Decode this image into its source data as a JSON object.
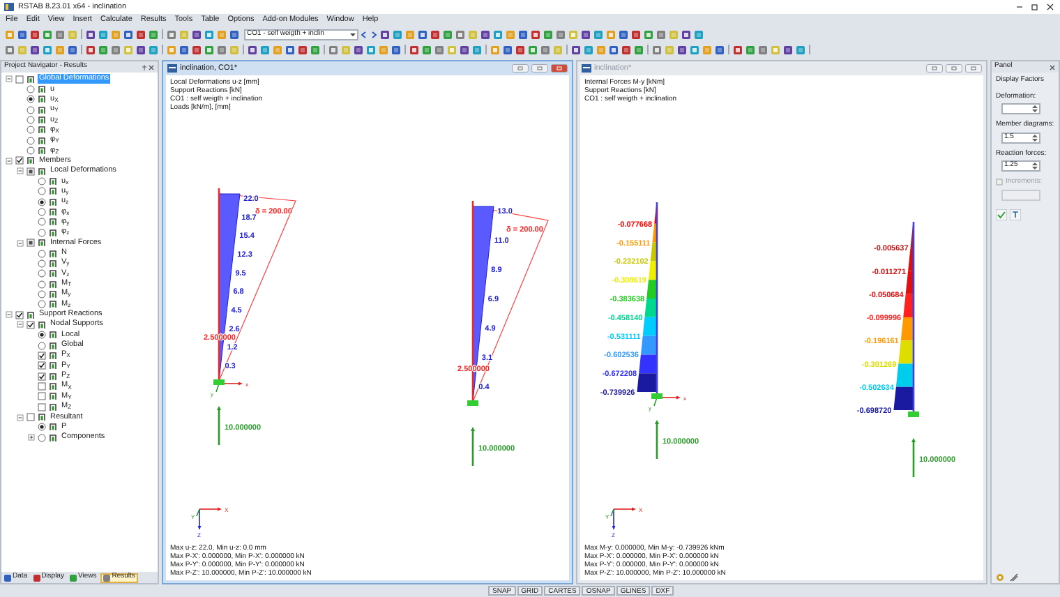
{
  "window": {
    "title": "RSTAB 8.23.01 x64 - inclination"
  },
  "menu": [
    "File",
    "Edit",
    "View",
    "Insert",
    "Calculate",
    "Results",
    "Tools",
    "Table",
    "Options",
    "Add-on Modules",
    "Window",
    "Help"
  ],
  "toolbar": {
    "load_case": "CO1 - self weigth + inclin"
  },
  "navigator": {
    "title": "Project Navigator - Results",
    "tree": [
      {
        "label": "Global Deformations",
        "kind": "check",
        "checked": false,
        "highlighted": true,
        "expanded": true,
        "children": [
          {
            "label": "u",
            "kind": "radio",
            "selected": false
          },
          {
            "label": "u$_{X}$",
            "kind": "radio",
            "selected": true
          },
          {
            "label": "u$_{Y}$",
            "kind": "radio",
            "selected": false
          },
          {
            "label": "u$_{Z}$",
            "kind": "radio",
            "selected": false
          },
          {
            "label": "φ$_{X}$",
            "kind": "radio",
            "selected": false
          },
          {
            "label": "φ$_{Y}$",
            "kind": "radio",
            "selected": false
          },
          {
            "label": "φ$_{Z}$",
            "kind": "radio",
            "selected": false
          }
        ]
      },
      {
        "label": "Members",
        "kind": "check",
        "checked": true,
        "highlighted": false,
        "expanded": true,
        "children": [
          {
            "label": "Local Deformations",
            "kind": "check",
            "checked": true,
            "partial": true,
            "expanded": true,
            "children": [
              {
                "label": "u$_{x}$",
                "kind": "radio",
                "selected": false
              },
              {
                "label": "u$_{y}$",
                "kind": "radio",
                "selected": false
              },
              {
                "label": "u$_{z}$",
                "kind": "radio",
                "selected": true
              },
              {
                "label": "φ$_{x}$",
                "kind": "radio",
                "selected": false
              },
              {
                "label": "φ$_{y}$",
                "kind": "radio",
                "selected": false
              },
              {
                "label": "φ$_{z}$",
                "kind": "radio",
                "selected": false
              }
            ]
          },
          {
            "label": "Internal Forces",
            "kind": "check",
            "checked": true,
            "partial": true,
            "expanded": true,
            "children": [
              {
                "label": "N",
                "kind": "radio",
                "selected": false
              },
              {
                "label": "V$_{y}$",
                "kind": "radio",
                "selected": false
              },
              {
                "label": "V$_{z}$",
                "kind": "radio",
                "selected": false
              },
              {
                "label": "M$_{T}$",
                "kind": "radio",
                "selected": false
              },
              {
                "label": "M$_{y}$",
                "kind": "radio",
                "selected": false
              },
              {
                "label": "M$_{z}$",
                "kind": "radio",
                "selected": false
              }
            ]
          }
        ]
      },
      {
        "label": "Support Reactions",
        "kind": "check",
        "checked": true,
        "highlighted": false,
        "expanded": true,
        "children": [
          {
            "label": "Nodal Supports",
            "kind": "check",
            "checked": true,
            "expanded": true,
            "children": [
              {
                "label": "Local",
                "kind": "radio",
                "selected": true
              },
              {
                "label": "Global",
                "kind": "radio",
                "selected": false
              },
              {
                "label": "P$_{X}$",
                "kind": "check",
                "checked": true
              },
              {
                "label": "P$_{Y}$",
                "kind": "check",
                "checked": true
              },
              {
                "label": "P$_{Z}$",
                "kind": "check",
                "checked": true
              },
              {
                "label": "M$_{X}$",
                "kind": "check",
                "checked": false
              },
              {
                "label": "M$_{Y}$",
                "kind": "check",
                "checked": false
              },
              {
                "label": "M$_{Z}$",
                "kind": "check",
                "checked": false
              }
            ]
          },
          {
            "label": "Resultant",
            "kind": "check",
            "checked": false,
            "expanded": true,
            "children": [
              {
                "label": "P",
                "kind": "radio",
                "selected": true
              },
              {
                "label": "Components",
                "kind": "radio",
                "selected": false,
                "expanded": false
              }
            ]
          }
        ]
      }
    ],
    "tabs": [
      {
        "label": "Data",
        "selected": false
      },
      {
        "label": "Display",
        "selected": false
      },
      {
        "label": "Views",
        "selected": false
      },
      {
        "label": "Results",
        "selected": true
      }
    ]
  },
  "views": [
    {
      "title": "inclination, CO1*",
      "active": true,
      "kind": "deformation",
      "info": [
        "Local Deformations u-z [mm]",
        "Support Reactions [kN]",
        "CO1 : self weigth + inclination",
        "Loads [kN/m], [mm]"
      ],
      "members": [
        {
          "values": [
            {
              "text": "22.0"
            },
            {
              "text": "18.7"
            },
            {
              "text": "15.4"
            },
            {
              "text": "12.3"
            },
            {
              "text": "9.5"
            },
            {
              "text": "6.8"
            },
            {
              "text": "4.5"
            },
            {
              "text": "2.6"
            },
            {
              "text": "1.2"
            },
            {
              "text": "0.3"
            }
          ],
          "load": "δ = 200.00",
          "load_mid": "2.500000",
          "reaction": "10.000000",
          "local_axes": [
            "x",
            "y"
          ]
        },
        {
          "values": [
            {
              "text": "13.0"
            },
            {
              "text": "11.0"
            },
            {
              "text": "8.9"
            },
            {
              "text": "6.9"
            },
            {
              "text": "4.9"
            },
            {
              "text": "3.1"
            },
            {
              "text": "0.4"
            }
          ],
          "load": "δ = 200.00",
          "load_mid": "2.500000",
          "reaction": "10.000000"
        }
      ],
      "axes": [
        "X",
        "Y",
        "Z"
      ],
      "footer": [
        "Max u-z: 22.0, Min u-z: 0.0 mm",
        "Max P-X': 0.000000, Min P-X': 0.000000 kN",
        "Max P-Y': 0.000000, Min P-Y': 0.000000 kN",
        "Max P-Z': 10.000000, Min P-Z': 10.000000 kN"
      ]
    },
    {
      "title": "inclination*",
      "active": false,
      "kind": "internal_forces",
      "info": [
        "Internal Forces M-y [kNm]",
        "Support Reactions [kN]",
        "CO1 : self weigth + inclination"
      ],
      "members": [
        {
          "values": [
            {
              "text": "-0.077668",
              "color": "#ff0000"
            },
            {
              "text": "-0.155111",
              "color": "#ff9900"
            },
            {
              "text": "-0.232102",
              "color": "#c8c800"
            },
            {
              "text": "-0.308619",
              "color": "#eeee00"
            },
            {
              "text": "-0.383638",
              "color": "#22cc22"
            },
            {
              "text": "-0.458140",
              "color": "#00d890"
            },
            {
              "text": "-0.531111",
              "color": "#00ccff"
            },
            {
              "text": "-0.602536",
              "color": "#3399ff"
            },
            {
              "text": "-0.672208",
              "color": "#3333ff"
            },
            {
              "text": "-0.739926",
              "color": "#1a1aa0"
            }
          ],
          "reaction": "10.000000",
          "local_axes": [
            "x",
            "y"
          ]
        },
        {
          "values": [
            {
              "text": "-0.005637",
              "color": "#c81010"
            },
            {
              "text": "-0.011271",
              "color": "#d81010"
            },
            {
              "text": "-0.050684",
              "color": "#e01010"
            },
            {
              "text": "-0.099996",
              "color": "#ff2020"
            },
            {
              "text": "-0.196161",
              "color": "#ff9900"
            },
            {
              "text": "-0.301269",
              "color": "#dddd00"
            },
            {
              "text": "-0.502634",
              "color": "#00ccee"
            },
            {
              "text": "-0.698720",
              "color": "#1a1aa0"
            }
          ],
          "reaction": "10.000000"
        }
      ],
      "axes": [
        "X",
        "Y",
        "Z"
      ],
      "footer": [
        "Max M-y: 0.000000, Min M-y: -0.739926 kNm",
        "Max P-X': 0.000000, Min P-X': 0.000000 kN",
        "Max P-Y': 0.000000, Min P-Y': 0.000000 kN",
        "Max P-Z': 10.000000, Min P-Z': 10.000000 kN"
      ]
    }
  ],
  "panel": {
    "title": "Panel",
    "section": "Display Factors",
    "fields": [
      {
        "label": "Deformation:",
        "kind": "spin"
      },
      {
        "label": "Member diagrams:",
        "kind": "spin",
        "value": "1.5"
      },
      {
        "label": "Reaction forces:",
        "kind": "spin",
        "value": "1.25"
      },
      {
        "label": "Increments:",
        "kind": "check",
        "checked": false,
        "disabled": true
      }
    ]
  },
  "status_bar": [
    "SNAP",
    "GRID",
    "CARTES",
    "OSNAP",
    "GLINES",
    "DXF"
  ]
}
